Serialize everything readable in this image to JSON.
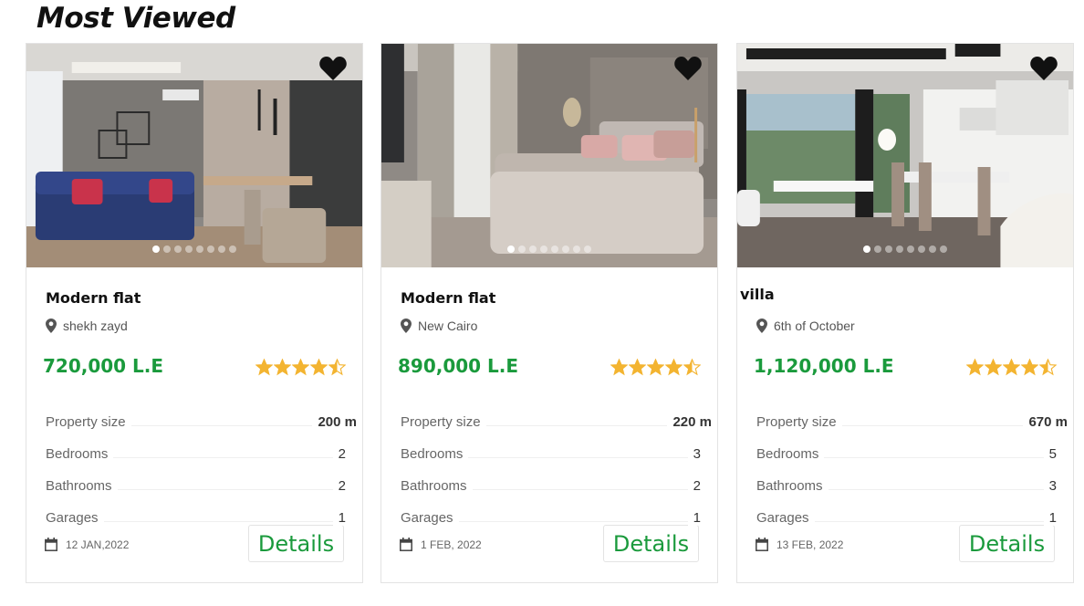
{
  "section_title": "Most Viewed",
  "colors": {
    "price": "#1a9a3c",
    "star": "#f3b431",
    "button_text": "#1a9a3c"
  },
  "listings": [
    {
      "title": "Modern flat",
      "location": "shekh zayd",
      "price": "720,000 L.E",
      "rating": 4.5,
      "image_icon": "living-room-photo",
      "specs": [
        {
          "label": "Property size",
          "value": "200 m"
        },
        {
          "label": "Bedrooms",
          "value": "2"
        },
        {
          "label": "Bathrooms",
          "value": "2"
        },
        {
          "label": "Garages",
          "value": "1"
        }
      ],
      "date": "12 JAN,2022",
      "button": "Details",
      "dots": 8,
      "active_dot": 0
    },
    {
      "title": "Modern flat",
      "location": "New Cairo",
      "price": "890,000 L.E",
      "rating": 4.5,
      "image_icon": "bedroom-photo",
      "specs": [
        {
          "label": "Property size",
          "value": "220 m"
        },
        {
          "label": "Bedrooms",
          "value": "3"
        },
        {
          "label": "Bathrooms",
          "value": "2"
        },
        {
          "label": "Garages",
          "value": "1"
        }
      ],
      "date": "1 FEB, 2022",
      "button": "Details",
      "dots": 8,
      "active_dot": 0
    },
    {
      "title": "villa",
      "location": "6th of October",
      "price": "1,120,000 L.E",
      "rating": 4.5,
      "image_icon": "dining-kitchen-photo",
      "specs": [
        {
          "label": "Property size",
          "value": "670 m"
        },
        {
          "label": "Bedrooms",
          "value": "5"
        },
        {
          "label": "Bathrooms",
          "value": "3"
        },
        {
          "label": "Garages",
          "value": "1"
        }
      ],
      "date": "13 FEB, 2022",
      "button": "Details",
      "dots": 8,
      "active_dot": 0
    }
  ]
}
